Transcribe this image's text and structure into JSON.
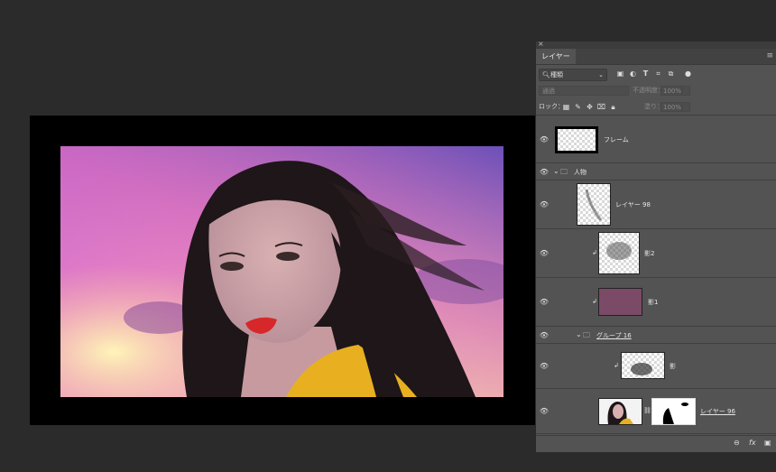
{
  "panel": {
    "close_glyph": "×",
    "tab_label": "レイヤー",
    "menu_glyph": "≡"
  },
  "filter": {
    "kind_label": "種類",
    "icons": [
      "image-filter-icon",
      "adjustment-filter-icon",
      "type-filter-icon",
      "shape-filter-icon",
      "smart-object-filter-icon",
      "filter-toggle-icon"
    ]
  },
  "blend": {
    "mode_value": "通過",
    "opacity_label": "不透明度：",
    "opacity_value": "100%"
  },
  "lock": {
    "label": "ロック：",
    "fill_label": "塗り：",
    "fill_value": "100%"
  },
  "layers": [
    {
      "name": "フレーム",
      "type": "frame"
    },
    {
      "name": "人物",
      "type": "group",
      "expanded": true
    },
    {
      "name": "レイヤー 98",
      "type": "layer"
    },
    {
      "name": "影2",
      "type": "layer",
      "clipped": true
    },
    {
      "name": "影1",
      "type": "layer",
      "clipped": true,
      "thumb_color": "#7a4a66"
    },
    {
      "name": "グループ 16",
      "type": "group",
      "expanded": true
    },
    {
      "name": "影",
      "type": "layer",
      "clipped": true
    },
    {
      "name": "レイヤー 96",
      "type": "layer",
      "masked": true
    }
  ],
  "footer": {
    "link_glyph": "⊖",
    "fx_label": "fx",
    "mask_glyph": "▣"
  },
  "colors": {
    "app_bg": "#2b2b2b",
    "panel_bg": "#535353",
    "canvas_border": "#000000"
  }
}
